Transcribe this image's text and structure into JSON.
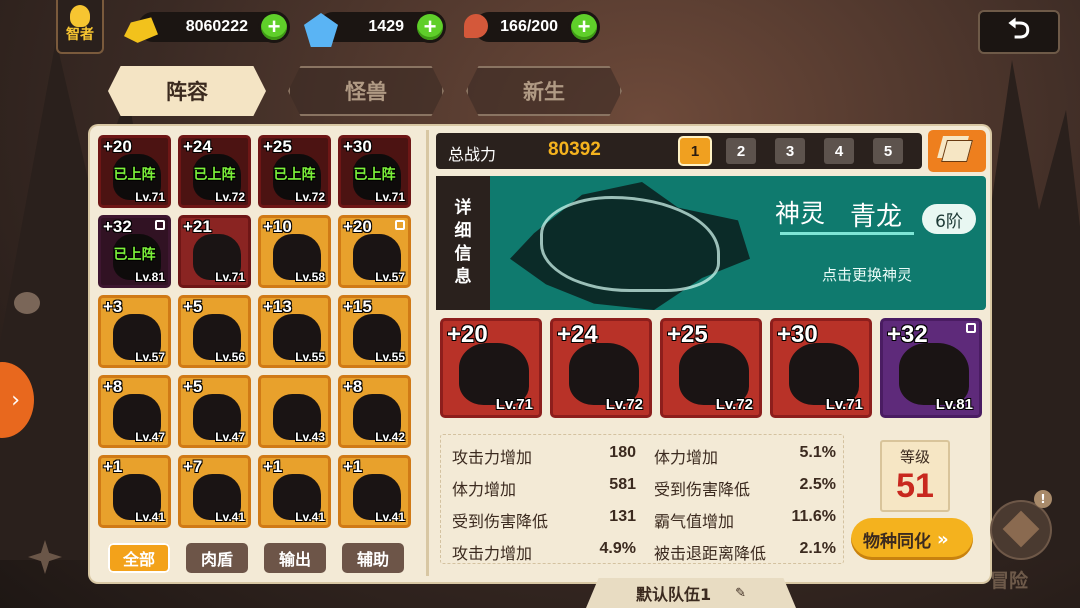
{
  "hud": {
    "title_badge": "智者",
    "gold": "8060222",
    "gems": "1429",
    "stamina": "166/200"
  },
  "tabs": [
    "阵容",
    "怪兽",
    "新生"
  ],
  "roster": [
    {
      "plus": "+20",
      "level": "Lv.71",
      "status": "已上阵",
      "color": "red"
    },
    {
      "plus": "+24",
      "level": "Lv.72",
      "status": "已上阵",
      "color": "red"
    },
    {
      "plus": "+25",
      "level": "Lv.72",
      "status": "已上阵",
      "color": "red"
    },
    {
      "plus": "+30",
      "level": "Lv.71",
      "status": "已上阵",
      "color": "red"
    },
    {
      "plus": "+32",
      "level": "Lv.81",
      "status": "已上阵",
      "color": "purple",
      "locked": true
    },
    {
      "plus": "+21",
      "level": "Lv.71",
      "status": "",
      "color": "red"
    },
    {
      "plus": "+10",
      "level": "Lv.58",
      "status": "",
      "color": "orange"
    },
    {
      "plus": "+20",
      "level": "Lv.57",
      "status": "",
      "color": "orange",
      "locked": true
    },
    {
      "plus": "+3",
      "level": "Lv.57",
      "status": "",
      "color": "orange"
    },
    {
      "plus": "+5",
      "level": "Lv.56",
      "status": "",
      "color": "orange"
    },
    {
      "plus": "+13",
      "level": "Lv.55",
      "status": "",
      "color": "orange"
    },
    {
      "plus": "+15",
      "level": "Lv.55",
      "status": "",
      "color": "orange"
    },
    {
      "plus": "+8",
      "level": "Lv.47",
      "status": "",
      "color": "orange"
    },
    {
      "plus": "+5",
      "level": "Lv.47",
      "status": "",
      "color": "orange"
    },
    {
      "plus": "",
      "level": "Lv.43",
      "status": "",
      "color": "orange"
    },
    {
      "plus": "+8",
      "level": "Lv.42",
      "status": "",
      "color": "orange"
    },
    {
      "plus": "+1",
      "level": "Lv.41",
      "status": "",
      "color": "orange"
    },
    {
      "plus": "+7",
      "level": "Lv.41",
      "status": "",
      "color": "orange"
    },
    {
      "plus": "+1",
      "level": "Lv.41",
      "status": "",
      "color": "orange"
    },
    {
      "plus": "+1",
      "level": "Lv.41",
      "status": "",
      "color": "orange"
    }
  ],
  "filters": [
    "全部",
    "肉盾",
    "输出",
    "辅助"
  ],
  "power": {
    "label": "总战力",
    "value": "80392"
  },
  "team_slots": [
    "1",
    "2",
    "3",
    "4",
    "5"
  ],
  "spirit": {
    "details_label": "详细信息",
    "type": "神灵",
    "name": "青龙",
    "rank": "6阶",
    "hint": "点击更换神灵"
  },
  "lineup": [
    {
      "plus": "+20",
      "level": "Lv.71",
      "color": "red"
    },
    {
      "plus": "+24",
      "level": "Lv.72",
      "color": "red"
    },
    {
      "plus": "+25",
      "level": "Lv.72",
      "color": "red"
    },
    {
      "plus": "+30",
      "level": "Lv.71",
      "color": "red"
    },
    {
      "plus": "+32",
      "level": "Lv.81",
      "color": "purple",
      "locked": true
    }
  ],
  "stats_left": [
    {
      "name": "攻击力增加",
      "value": "180"
    },
    {
      "name": "体力增加",
      "value": "581"
    },
    {
      "name": "受到伤害降低",
      "value": "131"
    },
    {
      "name": "攻击力增加",
      "value": "4.9%"
    }
  ],
  "stats_right": [
    {
      "name": "体力增加",
      "value": "5.1%"
    },
    {
      "name": "受到伤害降低",
      "value": "2.5%"
    },
    {
      "name": "霸气值增加",
      "value": "11.6%"
    },
    {
      "name": "被击退距离降低",
      "value": "2.1%"
    }
  ],
  "level_box": {
    "label": "等级",
    "value": "51"
  },
  "species_button": "物种同化",
  "team_name": "默认队伍1",
  "adventure_label": "冒险",
  "colors": {
    "gold": "#f0a020",
    "panel": "#f3ead6",
    "green_plus": "#5fcf2a",
    "teal": "#0f7a6e"
  }
}
